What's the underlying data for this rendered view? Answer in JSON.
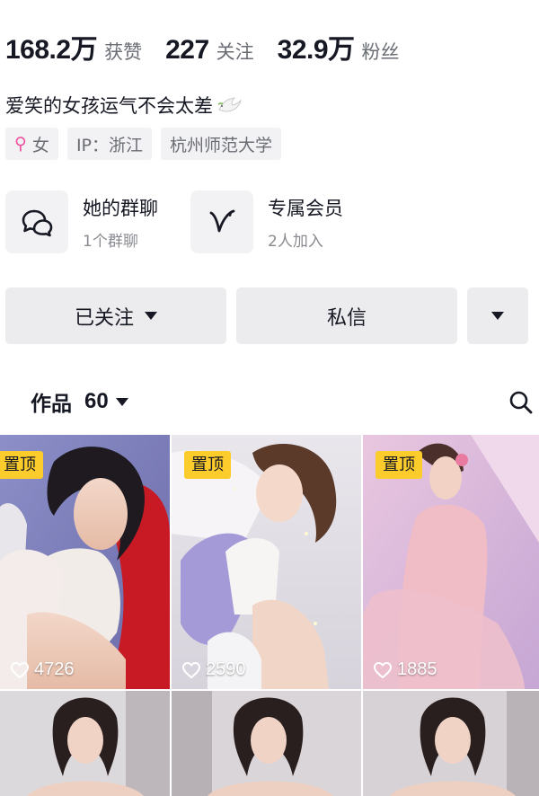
{
  "stats": [
    {
      "num": "168.2万",
      "label": "获赞"
    },
    {
      "num": "227",
      "label": "关注"
    },
    {
      "num": "32.9万",
      "label": "粉丝"
    }
  ],
  "bio": "爱笑的女孩运气不会太差",
  "tags": {
    "gender_icon": "female-symbol-icon",
    "gender": "女",
    "ip": "IP：浙江",
    "school": "杭州师范大学"
  },
  "cards": [
    {
      "icon": "chat-group-icon",
      "title": "她的群聊",
      "sub": "1个群聊"
    },
    {
      "icon": "v-membership-icon",
      "title": "专属会员",
      "sub": "2人加入"
    }
  ],
  "buttons": {
    "follow": "已关注",
    "message": "私信"
  },
  "works": {
    "label": "作品",
    "count": "60"
  },
  "videos": [
    {
      "pinned": "置顶",
      "likes": "4726"
    },
    {
      "pinned": "置顶",
      "likes": "2590"
    },
    {
      "pinned": "置顶",
      "likes": "1885"
    }
  ],
  "colors": {
    "accent_pin": "#fccb2c",
    "female": "#f0509e",
    "text": "#161823",
    "muted": "#6b6d75"
  }
}
